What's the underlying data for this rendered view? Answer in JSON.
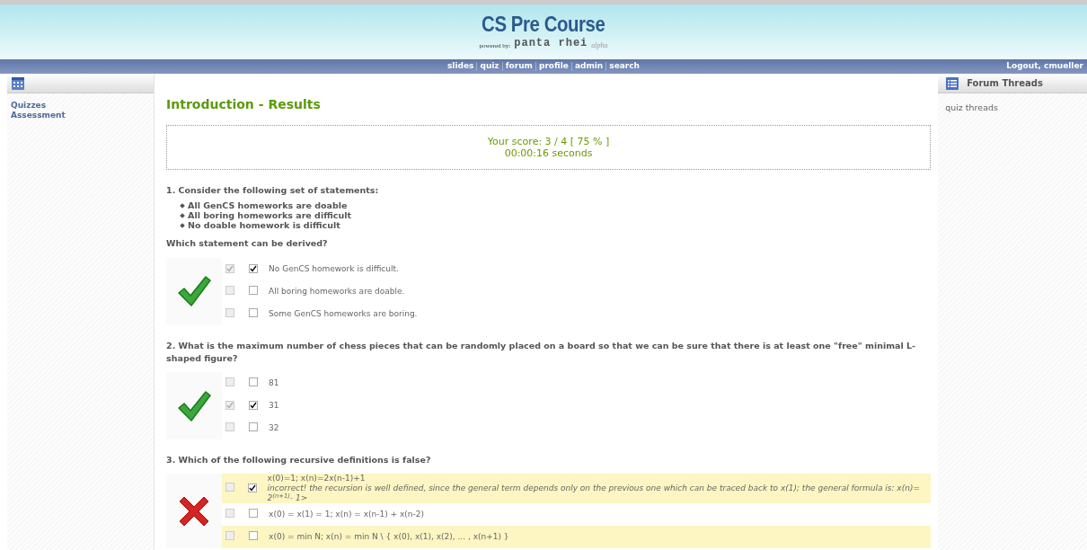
{
  "header": {
    "title": "CS Pre Course",
    "powered_by": "powered by:",
    "engine": "panta rhei",
    "stage": "alpha"
  },
  "nav": {
    "links": [
      "slides",
      "quiz",
      "forum",
      "profile",
      "admin",
      "search"
    ],
    "logout": "Logout, cmueller"
  },
  "sidebar": {
    "items": [
      "Quizzes",
      "Assessment"
    ]
  },
  "forum_panel": {
    "title": "Forum Threads",
    "items": [
      "quiz threads"
    ]
  },
  "page_title": "Introduction - Results",
  "score": {
    "line": "Your score: 3 / 4 [ 75 % ]",
    "time": "00:00:16 seconds"
  },
  "questions": [
    {
      "text": "1. Consider the following set of statements:",
      "bullets": [
        "All GenCS homeworks are doable",
        "All boring homeworks are difficult",
        "No doable homework is difficult"
      ],
      "prompt": "Which statement can be derived?",
      "correct": true,
      "options": [
        {
          "text": "No GenCS homework is difficult.",
          "correct": true,
          "answered": true,
          "highlighted": false
        },
        {
          "text": "All boring homeworks are doable.",
          "correct": false,
          "answered": false,
          "highlighted": false
        },
        {
          "text": "Some GenCS homeworks are boring.",
          "correct": false,
          "answered": false,
          "highlighted": false
        }
      ]
    },
    {
      "text": "2. What is the maximum number of chess pieces that can be randomly placed on a board so that we can be sure that there is at least one \"free\" minimal L-shaped figure?",
      "correct": true,
      "options": [
        {
          "text": "81",
          "correct": false,
          "answered": false,
          "highlighted": false
        },
        {
          "text": "31",
          "correct": true,
          "answered": true,
          "highlighted": false
        },
        {
          "text": "32",
          "correct": false,
          "answered": false,
          "highlighted": false
        }
      ]
    },
    {
      "text": "3. Which of the following recursive definitions is false?",
      "correct": false,
      "options": [
        {
          "text": "x(0)=1; x(n)=2x(n-1)+1",
          "feedback": "incorrect! the recursion is well defined, since the general term depends only on the previous one which can be traced back to x(1); the general formula is: x(n)= 2$^{(n+1)}$- 1>",
          "correct": false,
          "answered": true,
          "highlighted": true
        },
        {
          "text": "x(0) = x(1) = 1; x(n) = x(n-1) + x(n-2)",
          "correct": false,
          "answered": false,
          "highlighted": false
        },
        {
          "text": "x(0) = min N; x(n) = min N \\ { x(0), x(1), x(2), ... , x(n+1) }",
          "correct": false,
          "answered": false,
          "highlighted": true
        }
      ]
    }
  ]
}
